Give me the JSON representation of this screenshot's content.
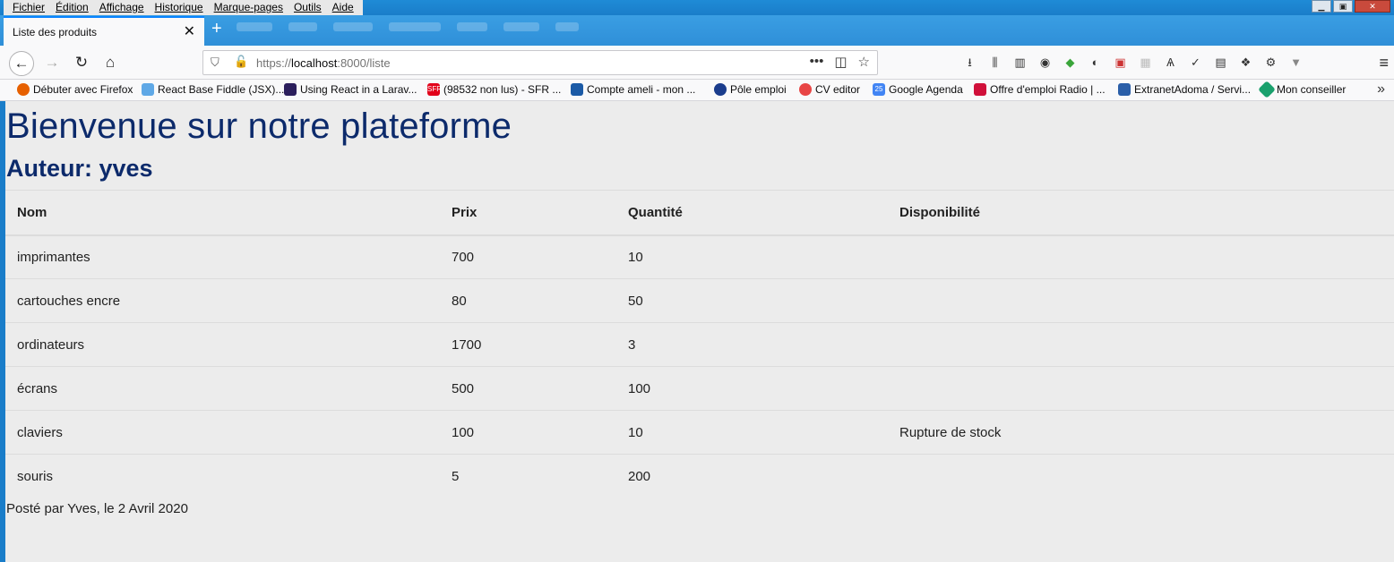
{
  "menu": [
    "Fichier",
    "Édition",
    "Affichage",
    "Historique",
    "Marque-pages",
    "Outils",
    "Aide"
  ],
  "window_controls": {
    "minimize": "▁",
    "maximize": "▣",
    "close": "✕"
  },
  "tab": {
    "title": "Liste des produits",
    "close": "✕",
    "new": "+"
  },
  "url": {
    "prefix": "https://",
    "host": "localhost",
    "path": ":8000/liste"
  },
  "bookmarks": [
    {
      "label": "Débuter avec Firefox",
      "icon": "firefox-icon",
      "color": "#e66000"
    },
    {
      "label": "React Base Fiddle (JSX)...",
      "icon": "fiddle-icon",
      "color": "#5fa8e6"
    },
    {
      "label": "Using React in a Larav...",
      "icon": "laravel-news-icon",
      "color": "#2b1e5c"
    },
    {
      "label": "(98532 non lus) - SFR ...",
      "icon": "sfr-icon",
      "color": "#e2001a"
    },
    {
      "label": "Compte ameli - mon ...",
      "icon": "ameli-icon",
      "color": "#1b5aa6"
    },
    {
      "label": "Pôle emploi",
      "icon": "pole-emploi-icon",
      "color": "#1a3c8c"
    },
    {
      "label": "CV editor",
      "icon": "cv-editor-icon",
      "color": "#e84545"
    },
    {
      "label": "Google Agenda",
      "icon": "calendar-icon",
      "color": "#4285f4"
    },
    {
      "label": "Offre d'emploi Radio | ...",
      "icon": "radio-icon",
      "color": "#d0103a"
    },
    {
      "label": "ExtranetAdoma / Servi...",
      "icon": "adoma-icon",
      "color": "#2a5ea8"
    },
    {
      "label": "Mon conseiller",
      "icon": "conseiller-icon",
      "color": "#1aa06d"
    }
  ],
  "page": {
    "heading": "Bienvenue sur notre plateforme",
    "author": "Auteur: yves",
    "footer": "Posté par Yves, le 2 Avril 2020"
  },
  "table": {
    "headers": [
      "Nom",
      "Prix",
      "Quantité",
      "Disponibilité"
    ],
    "rows": [
      [
        "imprimantes",
        "700",
        "10",
        ""
      ],
      [
        "cartouches encre",
        "80",
        "50",
        ""
      ],
      [
        "ordinateurs",
        "1700",
        "3",
        ""
      ],
      [
        "écrans",
        "500",
        "100",
        ""
      ],
      [
        "claviers",
        "100",
        "10",
        "Rupture de stock"
      ],
      [
        "souris",
        "5",
        "200",
        ""
      ]
    ]
  }
}
